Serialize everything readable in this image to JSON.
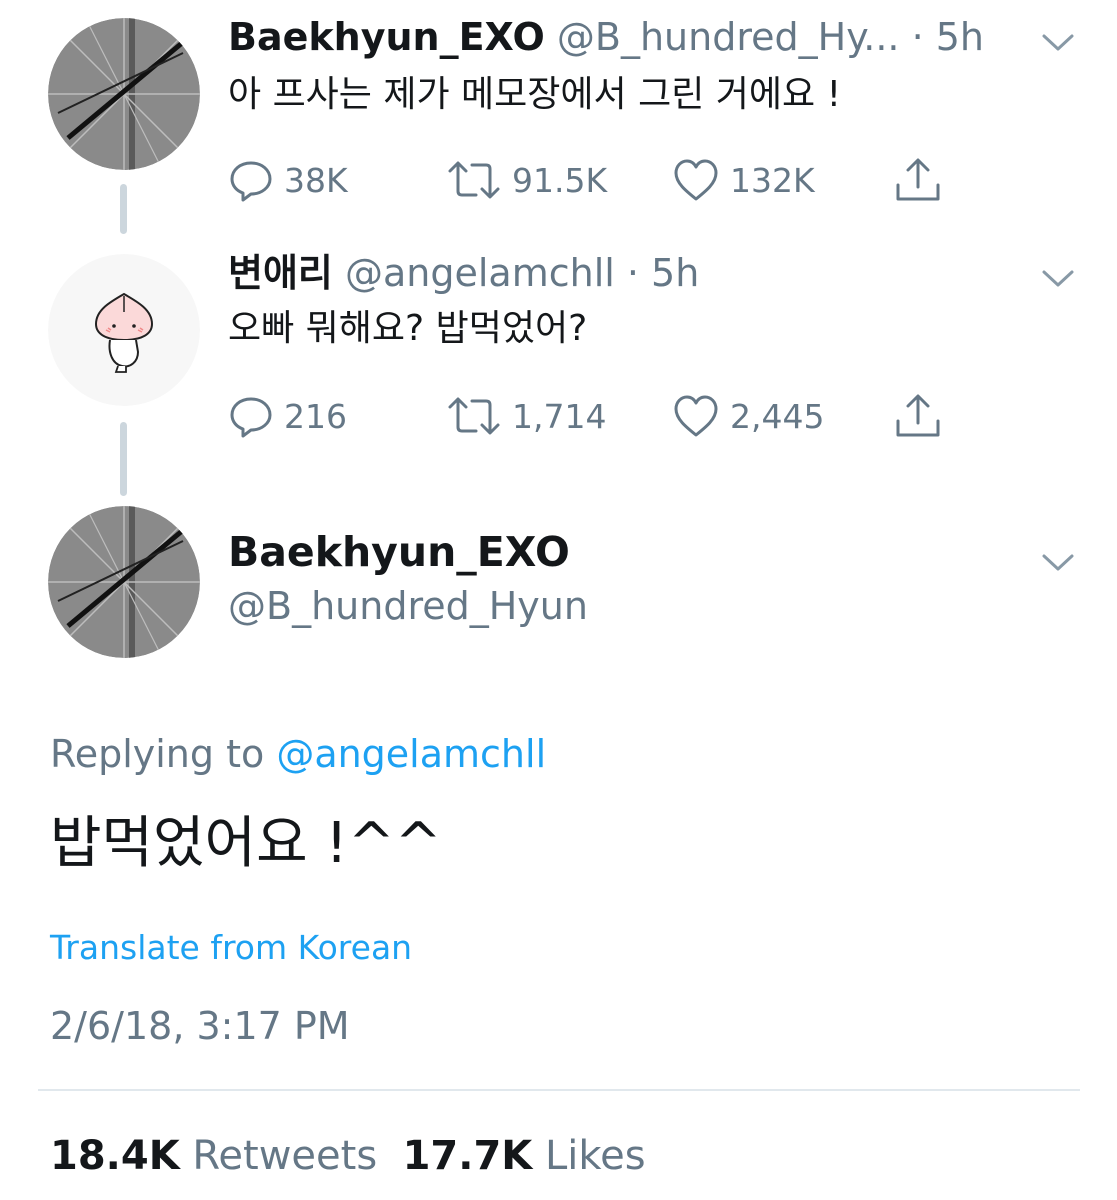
{
  "colors": {
    "accent": "#1da1f2",
    "secondary_text": "#657786",
    "primary_text": "#14171a",
    "thread_line": "#ccd6dd"
  },
  "tweet1": {
    "display_name": "Baekhyun_EXO",
    "handle": "@B_hundred_Hy...",
    "time": " · 5h",
    "text": "아 프사는 제가 메모장에서 그린 거에요 !",
    "replies": "38K",
    "retweets": "91.5K",
    "likes": "132K"
  },
  "tweet2": {
    "display_name": "변애리",
    "handle": "@angelamchll",
    "time": " · 5h",
    "text": "오빠 뭐해요? 밥먹었어?",
    "replies": "216",
    "retweets": "1,714",
    "likes": "2,445"
  },
  "main_tweet": {
    "display_name": "Baekhyun_EXO",
    "handle": "@B_hundred_Hyun",
    "replying_prefix": "Replying to ",
    "replying_to": "@angelamchll",
    "text": "밥먹었어요 !^^",
    "translate_label": "Translate from Korean",
    "timestamp": "2/6/18, 3:17 PM",
    "retweets_count": "18.4K",
    "retweets_label": "Retweets",
    "likes_count": "17.7K",
    "likes_label": "Likes"
  },
  "icons": {
    "reply": "reply-icon",
    "retweet": "retweet-icon",
    "like": "heart-icon",
    "share": "share-icon",
    "more": "chevron-down-icon"
  }
}
